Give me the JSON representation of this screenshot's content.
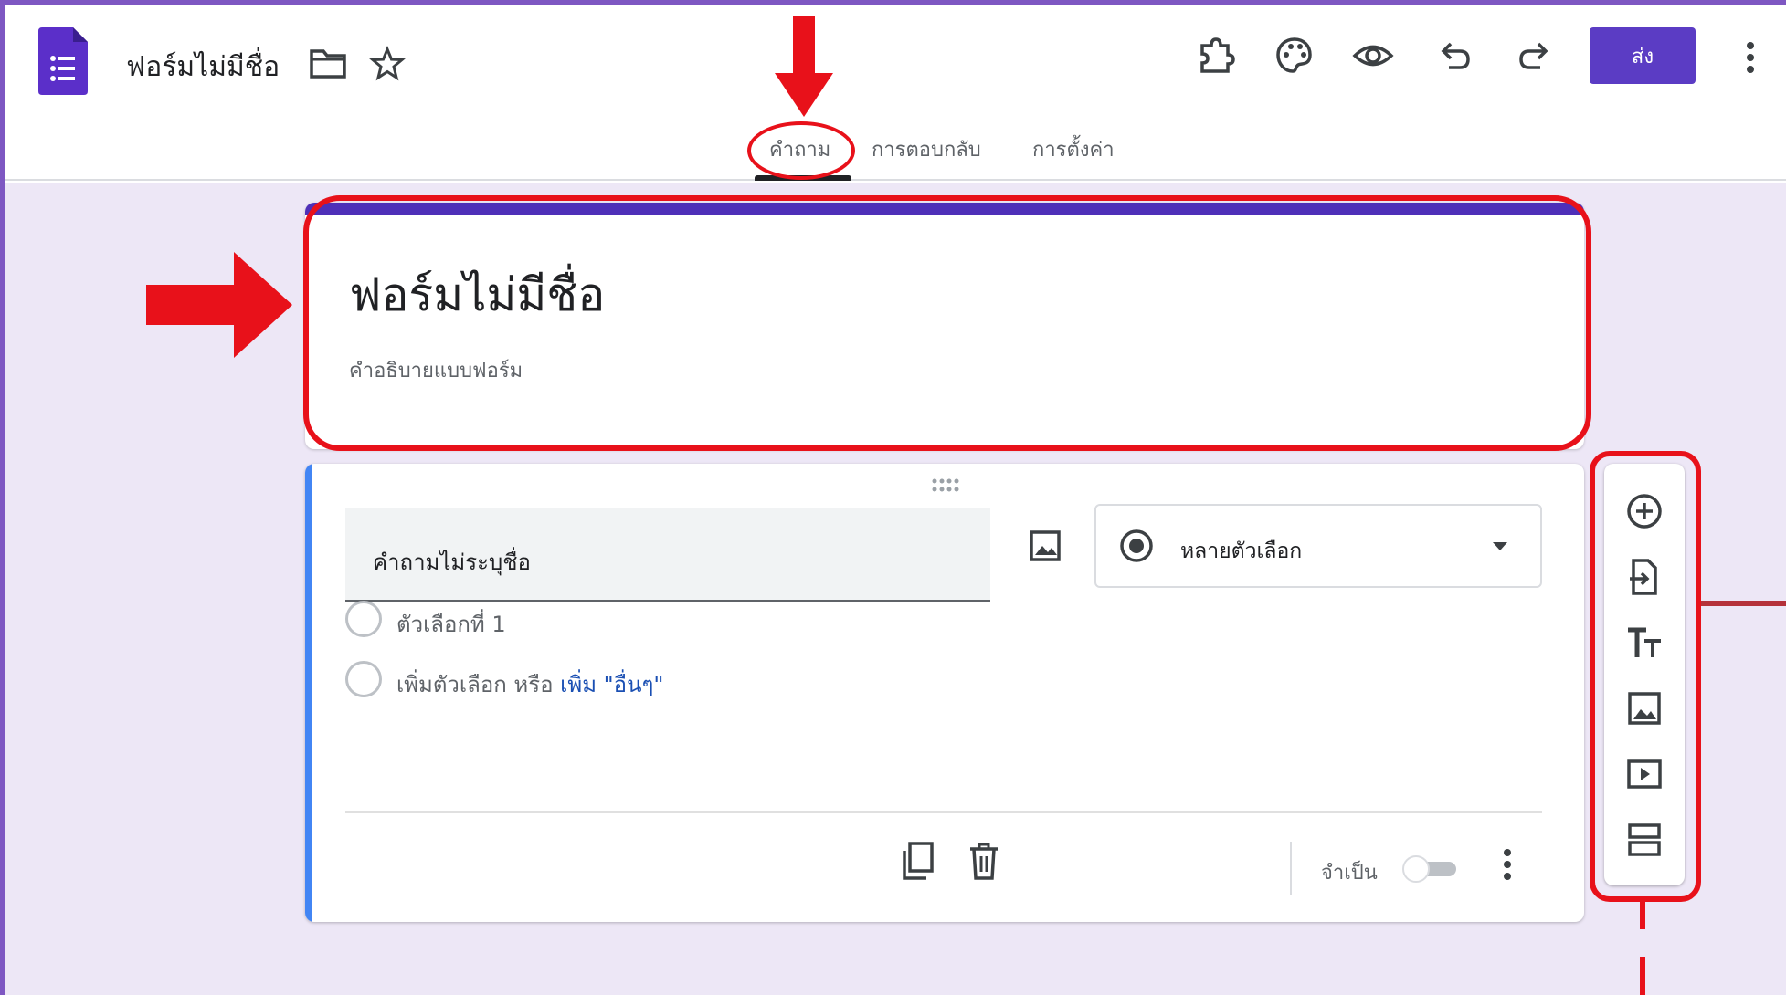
{
  "header": {
    "doc_title": "ฟอร์มไม่มีชื่อ",
    "send_label": "ส่ง",
    "tabs": [
      {
        "label": "คำถาม",
        "active": true
      },
      {
        "label": "การตอบกลับ",
        "active": false
      },
      {
        "label": "การตั้งค่า",
        "active": false
      }
    ],
    "icons": [
      "app-logo-icon",
      "folder-icon",
      "star-icon",
      "add-on-icon",
      "palette-icon",
      "preview-icon",
      "undo-icon",
      "redo-icon",
      "more-vert-icon"
    ]
  },
  "form": {
    "title": "ฟอร์มไม่มีชื่อ",
    "description_placeholder": "คำอธิบายแบบฟอร์ม"
  },
  "question": {
    "text": "คำถามไม่ระบุชื่อ",
    "type_label": "หลายตัวเลือก",
    "options": [
      {
        "label": "ตัวเลือกที่ 1"
      }
    ],
    "add_option_label": "เพิ่มตัวเลือก",
    "or_label": "หรือ",
    "add_other_label": "เพิ่ม \"อื่นๆ\"",
    "required_label": "จำเป็น",
    "required": false
  },
  "side_toolbar": {
    "icons": [
      "add-question-icon",
      "import-questions-icon",
      "add-title-icon",
      "add-image-icon",
      "add-video-icon",
      "add-section-icon"
    ]
  },
  "colors": {
    "accent": "#5b3cc4",
    "canvas_bg": "#ede7f6",
    "highlight_red": "#e8111a",
    "question_bar": "#4285f4"
  }
}
